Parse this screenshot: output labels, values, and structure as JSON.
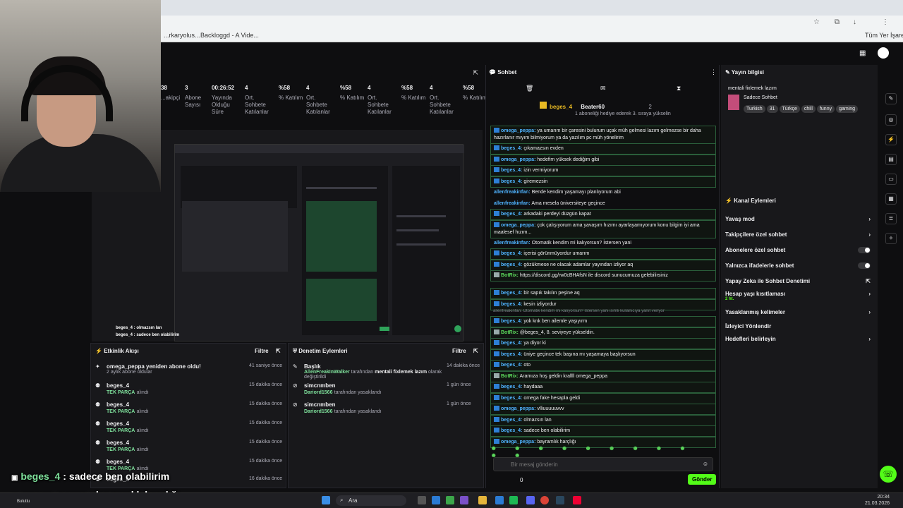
{
  "browser": {
    "bookmarks": [
      "...rkaryolus...",
      "Backloggd - A Vide...",
      "Tüm Yer İşaretleri"
    ]
  },
  "stats": [
    {
      "value": "38",
      "label": "...akipçi"
    },
    {
      "value": "3",
      "label": "Abone Sayısı"
    },
    {
      "value": "00:26:52",
      "label": "Yayında Olduğu Süre"
    },
    {
      "value": "4",
      "label": "Ort. Sohbete Katılanlar"
    },
    {
      "value": "%58",
      "label": "% Katılım"
    },
    {
      "value": "4",
      "label": "Ort. Sohbete Katılanlar"
    },
    {
      "value": "%58",
      "label": "% Katılım"
    },
    {
      "value": "4",
      "label": "Ort. Sohbete Katılanlar"
    },
    {
      "value": "%58",
      "label": "% Katılım"
    },
    {
      "value": "4",
      "label": "Ort. Sohbete Katılanlar"
    },
    {
      "value": "%58",
      "label": "% Katılım"
    }
  ],
  "preview": {
    "overlay1": "beges_4 : olmazsın lan",
    "overlay2": "beges_4 : sadece ben olabilirim"
  },
  "activity": {
    "title": "Etkinlik Akışı",
    "filter": "Filtre",
    "items": [
      {
        "name": "omega_peppa yeniden abone oldu!",
        "sub": "2 aylık abone oldular",
        "time": "41 saniye önce",
        "green": ""
      },
      {
        "name": "beges_4",
        "sub": "alındı",
        "green": "TEK PARÇA",
        "time": "15 dakika önce"
      },
      {
        "name": "beges_4",
        "sub": "alındı",
        "green": "TEK PARÇA",
        "time": "15 dakika önce"
      },
      {
        "name": "beges_4",
        "sub": "alındı",
        "green": "TEK PARÇA",
        "time": "15 dakika önce"
      },
      {
        "name": "beges_4",
        "sub": "alındı",
        "green": "TEK PARÇA",
        "time": "15 dakika önce"
      },
      {
        "name": "beges_4",
        "sub": "alındı",
        "green": "TEK PARÇA",
        "time": "15 dakika önce"
      },
      {
        "name": "beges_4",
        "sub": "alındı",
        "green": "TEK PARÇA",
        "time": "16 dakika önce"
      }
    ]
  },
  "moderation": {
    "title": "Denetim Eylemleri",
    "filter": "Filtre",
    "items": [
      {
        "name": "Başlık",
        "green": "AllenFreakInWalker",
        "sub": "tarafından",
        "bold2": "mentali fixlemek lazım",
        "sub2": "olarak değiştirildi",
        "time": "14 dakika önce"
      },
      {
        "name": "simcnmben",
        "green": "Dariord1566",
        "sub": "tarafından yasaklandı",
        "time": "1 gün önce"
      },
      {
        "name": "simcnmben",
        "green": "Dariord1566",
        "sub": "tarafından yasaklandı",
        "time": "1 gün önce"
      }
    ]
  },
  "chat": {
    "title": "Sohbet",
    "leader1": "beges_4",
    "leader1_count": "4",
    "leader2": "Beater60",
    "leader2_count": "2",
    "gift_text": "1 aboneliği hediye ederek 3. sıraya yükselin",
    "input_placeholder": "Bir mesaj gönderin",
    "send_label": "Gönder",
    "points": "0",
    "messages": [
      {
        "user": "omega_peppa:",
        "text": "ya umarım bir çaresini bulurum uçak müh gelmesi lazım gelmezse bir daha hazırlanır mıyım bilmiyorum ya da yazılım pc müh yönelirim",
        "hl": true,
        "userColor": "blue"
      },
      {
        "user": "beges_4:",
        "text": "çıkamazsın evden",
        "hl": true,
        "userColor": "blue"
      },
      {
        "user": "omega_peppa:",
        "text": "hedefim yüksek dediğim gibi",
        "hl": true,
        "userColor": "blue"
      },
      {
        "user": "beges_4:",
        "text": "izin vermiyorum",
        "hl": true,
        "userColor": "blue"
      },
      {
        "user": "beges_4:",
        "text": "giremezsin",
        "hl": true,
        "userColor": "blue"
      },
      {
        "user": "allenfreakinfan:",
        "text": "Bende kendim yaşamayı planlıyorum abi",
        "hl": false,
        "userColor": "blue"
      },
      {
        "user": "allenfreakinfan:",
        "text": "Ama mesela üniversiteye geçince",
        "hl": false,
        "userColor": "blue"
      },
      {
        "user": "beges_4:",
        "text": "arkadaki perdeyi düzgün kapat",
        "hl": true,
        "userColor": "blue"
      },
      {
        "user": "omega_peppa:",
        "text": "çok çalışıyorum ama yavaşım hızımı ayarlayamıyorum konu bilgim iyi ama maalesef hızım...",
        "hl": true,
        "userColor": "blue"
      },
      {
        "user": "allenfreakinfan:",
        "text": "Otomatik kendim mi kalıyorsun? İstersen yani",
        "hl": false,
        "userColor": "blue"
      },
      {
        "user": "beges_4:",
        "text": "içerisi görünmüyordur umarım",
        "hl": true,
        "userColor": "blue"
      },
      {
        "user": "beges_4:",
        "text": "gözükmese ne olacak adamlar yayından izliyor aq",
        "hl": true,
        "userColor": "blue"
      },
      {
        "user": "BotRix:",
        "text": "https://discord.gg/rw0cBHAfsN ile discord sunucumuza gelebilirsiniz",
        "hl": true,
        "userColor": "green"
      },
      {
        "user": "beges_4:",
        "text": "bir sapık takılın peşine aq",
        "hl": true,
        "userColor": "blue"
      },
      {
        "user": "beges_4:",
        "text": "kesin izliyordur",
        "hl": true,
        "userColor": "blue"
      },
      {
        "user": "beges_4:",
        "text": "yok knk ben ailemle yaşıyırm",
        "hl": true,
        "userColor": "blue",
        "reply": "allenfreakinfan: Otomatik kendim mi kalıyorsun? İstersen yani isimli kullanıcıya yanıt veriyor"
      },
      {
        "user": "BotRix:",
        "text": "@beges_4, 8. seviyeye yükseldin.",
        "hl": true,
        "userColor": "green"
      },
      {
        "user": "beges_4:",
        "text": "ya diyor ki",
        "hl": true,
        "userColor": "blue"
      },
      {
        "user": "beges_4:",
        "text": "üniye geçince tek başına mı yaşamaya başlıyorsun",
        "hl": true,
        "userColor": "blue"
      },
      {
        "user": "beges_4:",
        "text": "oto",
        "hl": true,
        "userColor": "blue"
      },
      {
        "user": "BotRix:",
        "text": "Aramıza hoş geldin krallll omega_peppa",
        "hl": true,
        "userColor": "green"
      },
      {
        "user": "beges_4:",
        "text": "haydaaa",
        "hl": true,
        "userColor": "blue"
      },
      {
        "user": "beges_4:",
        "text": "omega fake hesapla geldi",
        "hl": true,
        "userColor": "blue"
      },
      {
        "user": "omega_peppa:",
        "text": "vlliuuuuuvvv",
        "hl": true,
        "userColor": "blue"
      },
      {
        "user": "beges_4:",
        "text": "olmazsın lan",
        "hl": true,
        "userColor": "blue"
      },
      {
        "user": "beges_4:",
        "text": "sadece ben olabilirim",
        "hl": true,
        "userColor": "blue"
      },
      {
        "user": "omega_peppa:",
        "text": "bayramlık harçlığı",
        "hl": true,
        "userColor": "blue"
      }
    ]
  },
  "stream_info": {
    "title": "Yayın bilgisi",
    "stream_title": "mentali fixlemek lazım",
    "category": "Sadece Sohbet",
    "tags": [
      "Turkish",
      "31",
      "Türkçe",
      "chill",
      "funny",
      "gaming"
    ]
  },
  "channel_actions": {
    "title": "Kanal Eylemleri",
    "items": [
      {
        "label": "Yavaş mod",
        "kind": "chevron"
      },
      {
        "label": "Takipçilere özel sohbet",
        "kind": "chevron"
      },
      {
        "label": "Abonelere özel sohbet",
        "kind": "toggle"
      },
      {
        "label": "Yalnızca ifadelerle sohbet",
        "kind": "toggle"
      },
      {
        "label": "Yapay Zeka ile Sohbet Denetimi",
        "kind": "ext"
      },
      {
        "label": "Hesap yaşı kısıtlaması",
        "kind": "chevron",
        "sub": "2 ht."
      },
      {
        "label": "Yasaklanmış kelimeler",
        "kind": "chevron"
      },
      {
        "label": "İzleyici Yönlendir",
        "kind": "none"
      },
      {
        "label": "Hedefleri belirleyin",
        "kind": "chevron"
      }
    ]
  },
  "overlay_chat": [
    {
      "user": "beges_4",
      "text": ": sadece ben olabilirim"
    },
    {
      "user": "omega_peppa",
      "text": ": bayramlık harçlığı"
    }
  ],
  "weather": "Bulutlu",
  "taskbar": {
    "search": "Ara",
    "time": "20:34",
    "date": "21.03.2026"
  }
}
